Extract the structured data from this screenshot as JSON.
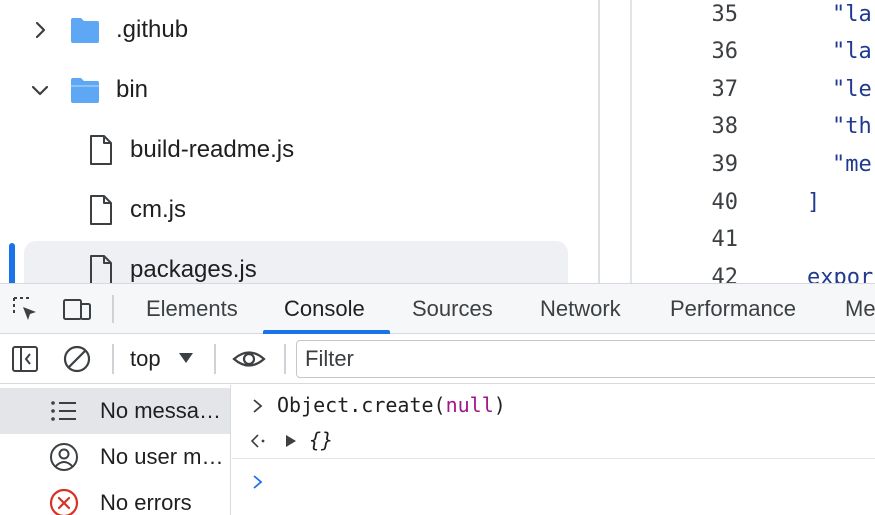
{
  "file_tree": {
    "items": [
      {
        "label": ".github",
        "kind": "folder",
        "expanded": false
      },
      {
        "label": "bin",
        "kind": "folder",
        "expanded": true
      },
      {
        "label": "build-readme.js",
        "kind": "file"
      },
      {
        "label": "cm.js",
        "kind": "file"
      },
      {
        "label": "packages.js",
        "kind": "file",
        "selected": true
      }
    ]
  },
  "editor": {
    "lines": [
      {
        "num": "35",
        "code": "\"la"
      },
      {
        "num": "36",
        "code": "\"la"
      },
      {
        "num": "37",
        "code": "\"le"
      },
      {
        "num": "38",
        "code": "\"th"
      },
      {
        "num": "39",
        "code": "\"me"
      },
      {
        "num": "40",
        "code": "]"
      },
      {
        "num": "41",
        "code": ""
      },
      {
        "num": "42",
        "code": "expor"
      }
    ]
  },
  "devtools": {
    "tabs": [
      "Elements",
      "Console",
      "Sources",
      "Network",
      "Performance",
      "Me"
    ],
    "active_tab": "Console"
  },
  "console_toolbar": {
    "context": "top",
    "filter_placeholder": "Filter"
  },
  "sidebar": {
    "items": [
      {
        "label": "No messa…",
        "icon": "list-icon"
      },
      {
        "label": "No user m…",
        "icon": "user-icon"
      },
      {
        "label": "No errors",
        "icon": "error-icon"
      }
    ]
  },
  "console": {
    "input_fn": "Object.create(",
    "input_arg": "null",
    "input_close": ")",
    "output": "{}"
  },
  "colors": {
    "accent": "#1a73e8",
    "folder": "#5ea7f5",
    "error": "#d93025",
    "keyword": "#a3158c"
  }
}
